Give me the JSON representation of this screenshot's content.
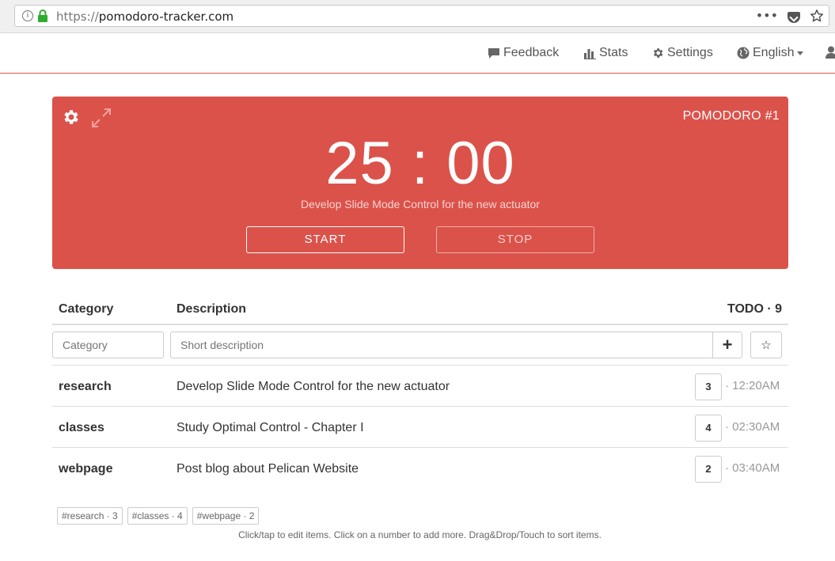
{
  "browser": {
    "url_protocol": "https://",
    "url_host": "pomodoro-tracker.com",
    "more_icon": "•••"
  },
  "nav": {
    "feedback": "Feedback",
    "stats": "Stats",
    "settings": "Settings",
    "language": "English"
  },
  "timer": {
    "label": "POMODORO #1",
    "minutes": "25",
    "separator": ":",
    "seconds": "00",
    "current_task": "Develop Slide Mode Control for the new actuator",
    "start": "START",
    "stop": "STOP",
    "color": "#db524b"
  },
  "table": {
    "col_category": "Category",
    "col_description": "Description",
    "todo": "TODO · 9",
    "category_placeholder": "Category",
    "description_placeholder": "Short description",
    "add_symbol": "+",
    "star_symbol": "☆",
    "rows": [
      {
        "category": "research",
        "description": "Develop Slide Mode Control for the new actuator",
        "count": "3",
        "time": "· 12:20AM"
      },
      {
        "category": "classes",
        "description": "Study Optimal Control - Chapter I",
        "count": "4",
        "time": "· 02:30AM"
      },
      {
        "category": "webpage",
        "description": "Post blog about Pelican Website",
        "count": "2",
        "time": "· 03:40AM"
      }
    ]
  },
  "tags": [
    "#research · 3",
    "#classes · 4",
    "#webpage · 2"
  ],
  "help_text": "Click/tap to edit items. Click on a number to add more. Drag&Drop/Touch to sort items."
}
